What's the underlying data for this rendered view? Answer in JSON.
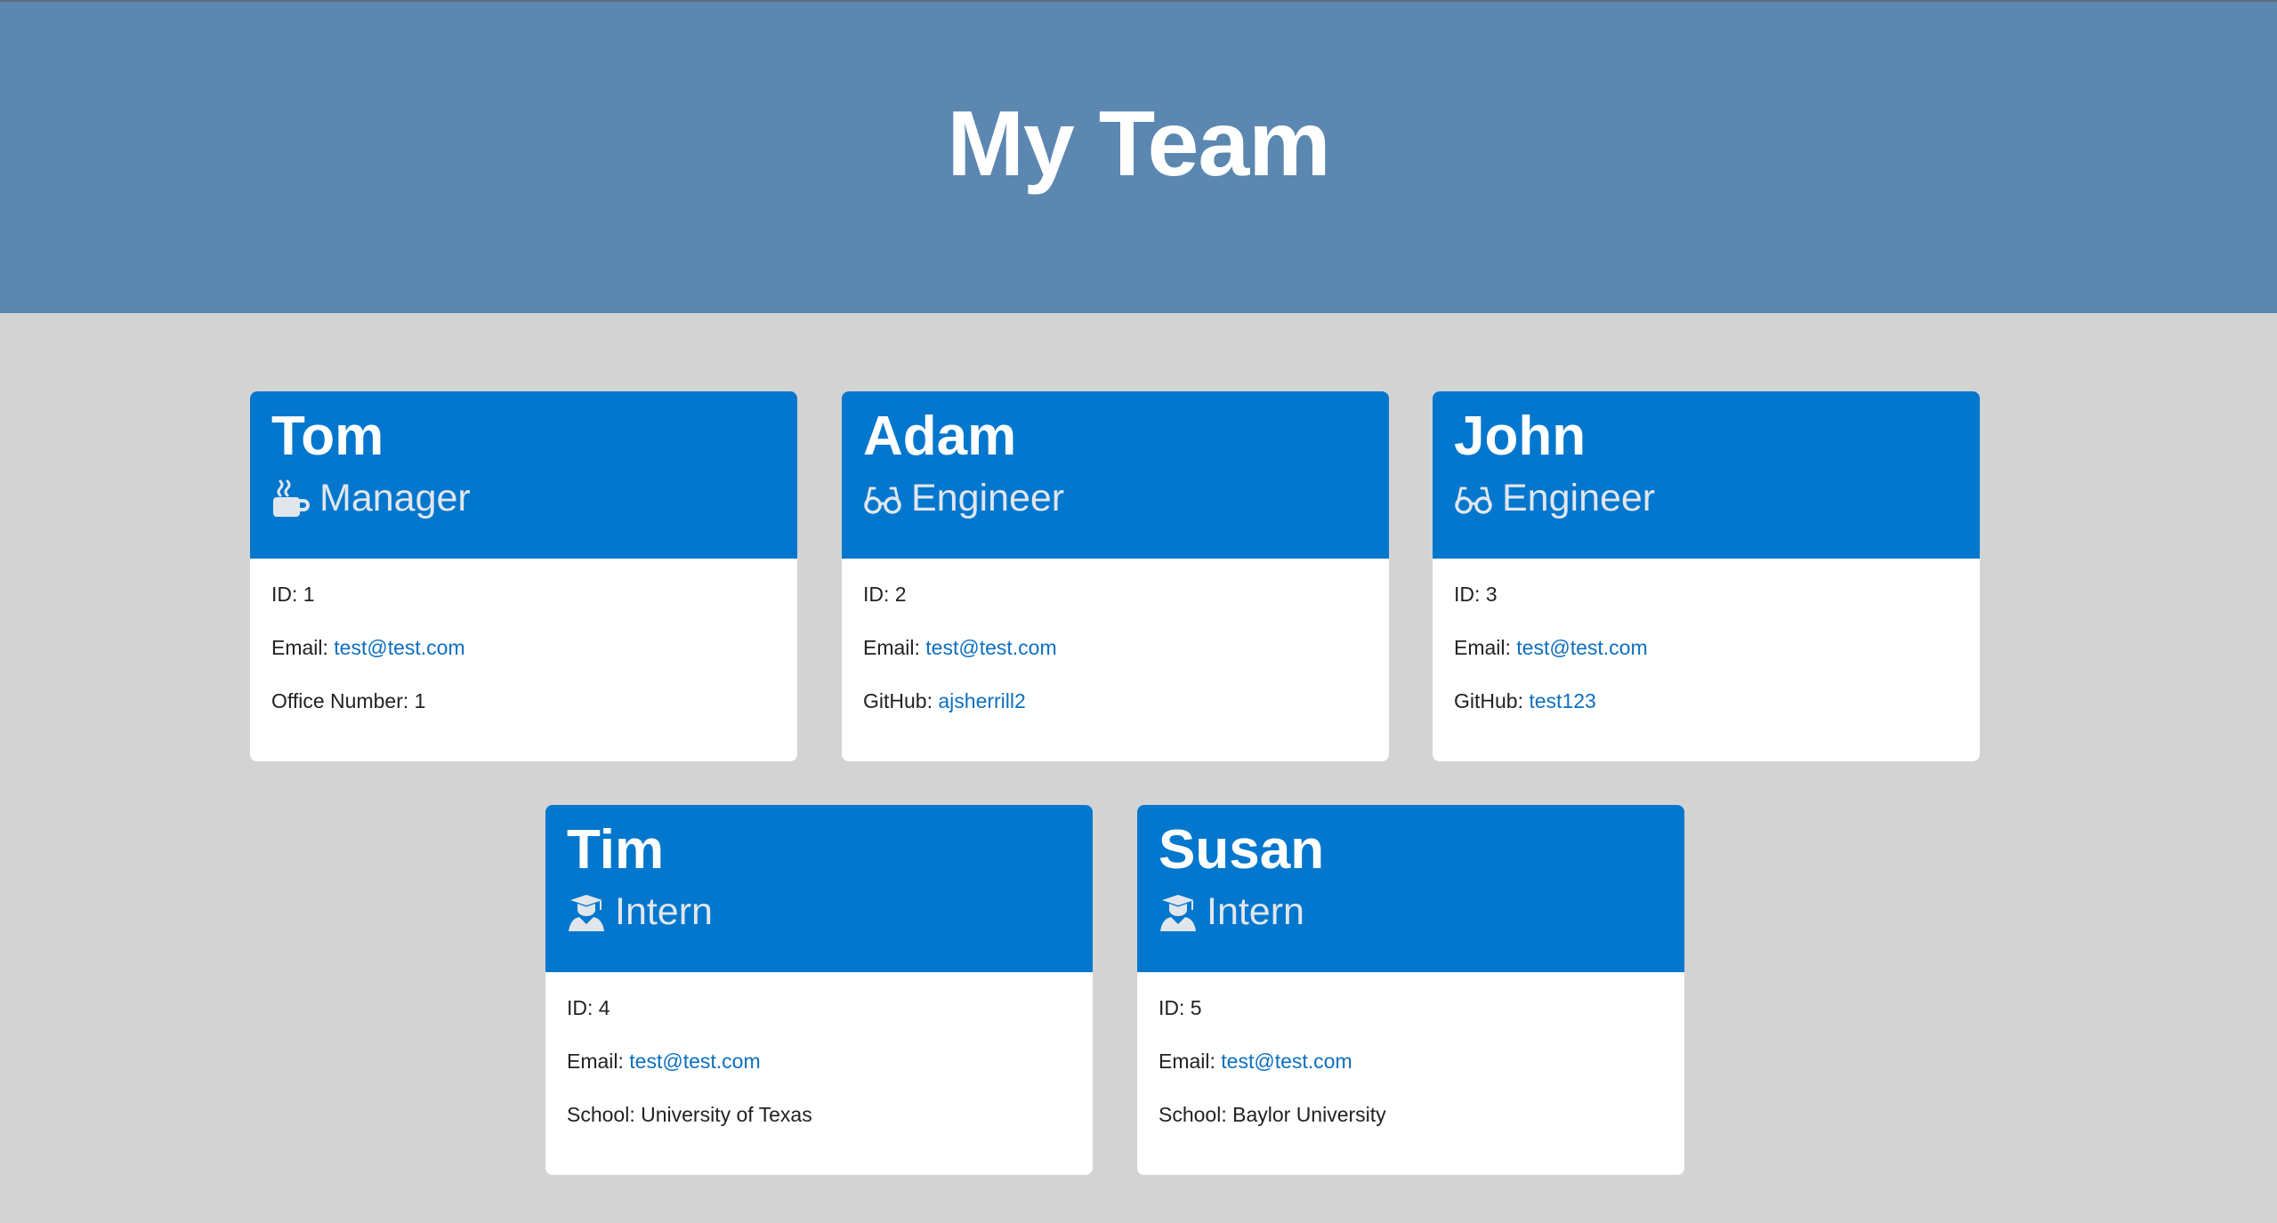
{
  "page": {
    "title": "My Team",
    "colors": {
      "header_bg": "#5b87b1",
      "page_bg": "#d3d3d3",
      "card_head_bg": "#0277cd",
      "link": "#0d6fc0"
    }
  },
  "labels": {
    "id": "ID: ",
    "email": "Email: ",
    "office": "Office Number: ",
    "github": "GitHub: ",
    "school": "School: "
  },
  "team": [
    {
      "name": "Tom",
      "role": "Manager",
      "icon": "coffee-mug-icon",
      "id": "1",
      "email": "test@test.com",
      "office_number": "1"
    },
    {
      "name": "Adam",
      "role": "Engineer",
      "icon": "glasses-icon",
      "id": "2",
      "email": "test@test.com",
      "github": "ajsherrill2"
    },
    {
      "name": "John",
      "role": "Engineer",
      "icon": "glasses-icon",
      "id": "3",
      "email": "test@test.com",
      "github": "test123"
    },
    {
      "name": "Tim",
      "role": "Intern",
      "icon": "graduate-icon",
      "id": "4",
      "email": "test@test.com",
      "school": "University of Texas"
    },
    {
      "name": "Susan",
      "role": "Intern",
      "icon": "graduate-icon",
      "id": "5",
      "email": "test@test.com",
      "school": "Baylor University"
    }
  ]
}
